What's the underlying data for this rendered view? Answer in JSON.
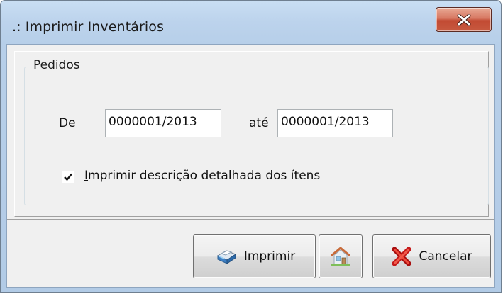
{
  "window": {
    "title": ".: Imprimir Inventários",
    "close_icon": "close-x-icon"
  },
  "group": {
    "legend": "Pedidos"
  },
  "range": {
    "from_label": "De",
    "from_value": "0000001/2013",
    "to_label_accel": "a",
    "to_label_rest": "té",
    "to_value": "0000001/2013"
  },
  "detail_option": {
    "checked": true,
    "label_accel": "I",
    "label_rest": "mprimir descrição detalhada dos ítens"
  },
  "buttons": {
    "print": {
      "icon": "printer-icon",
      "label_accel": "I",
      "label_rest": "mprimir"
    },
    "home": {
      "icon": "home-icon"
    },
    "cancel": {
      "icon": "red-x-icon",
      "label_accel": "C",
      "label_rest": "ancelar"
    }
  }
}
